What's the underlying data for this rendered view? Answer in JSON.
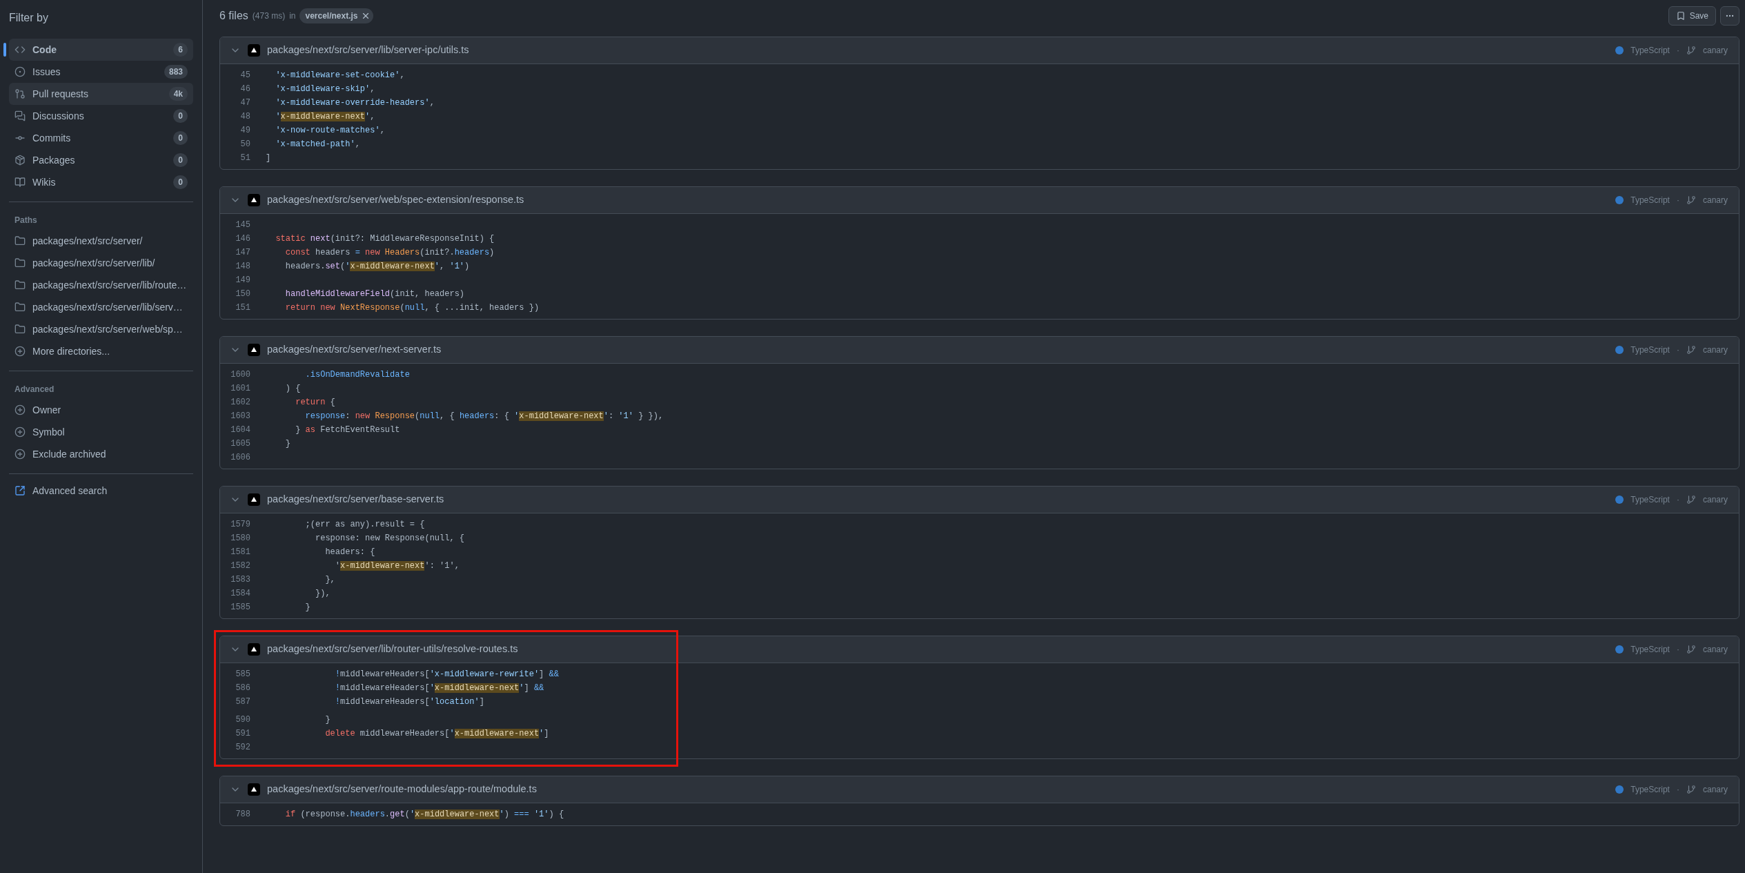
{
  "sidebar": {
    "title": "Filter by",
    "types": [
      {
        "label": "Code",
        "count": "6",
        "selected": true,
        "hovered": false
      },
      {
        "label": "Issues",
        "count": "883",
        "selected": false,
        "hovered": false
      },
      {
        "label": "Pull requests",
        "count": "4k",
        "selected": false,
        "hovered": true
      },
      {
        "label": "Discussions",
        "count": "0",
        "selected": false,
        "hovered": false
      },
      {
        "label": "Commits",
        "count": "0",
        "selected": false,
        "hovered": false
      },
      {
        "label": "Packages",
        "count": "0",
        "selected": false,
        "hovered": false
      },
      {
        "label": "Wikis",
        "count": "0",
        "selected": false,
        "hovered": false
      }
    ],
    "paths_heading": "Paths",
    "paths": [
      "packages/next/src/server/",
      "packages/next/src/server/lib/",
      "packages/next/src/server/lib/route…",
      "packages/next/src/server/lib/serv…",
      "packages/next/src/server/web/sp…"
    ],
    "more_directories": "More directories...",
    "advanced_heading": "Advanced",
    "advanced": [
      "Owner",
      "Symbol",
      "Exclude archived"
    ],
    "advanced_search": "Advanced search"
  },
  "results": {
    "count": "6 files",
    "timing": "(473 ms)",
    "in": "in",
    "repo": "vercel/next.js",
    "save": "Save"
  },
  "files": [
    {
      "path": "packages/next/src/server/lib/server-ipc/utils.ts",
      "language": "TypeScript",
      "color": "#3178c6",
      "separator": "·",
      "branch": "canary",
      "annotated": false,
      "lines": [
        {
          "number": "45",
          "tokens": [
            {
              "kind": "string",
              "text": "  'x-middleware-set-cookie'"
            },
            {
              "kind": "plain",
              "text": ","
            }
          ]
        },
        {
          "number": "46",
          "tokens": [
            {
              "kind": "string",
              "text": "  'x-middleware-skip'"
            },
            {
              "kind": "plain",
              "text": ","
            }
          ]
        },
        {
          "number": "47",
          "tokens": [
            {
              "kind": "string",
              "text": "  'x-middleware-override-headers'"
            },
            {
              "kind": "plain",
              "text": ","
            }
          ]
        },
        {
          "number": "48",
          "tokens": [
            {
              "kind": "string",
              "text": "  '"
            },
            {
              "kind": "match",
              "text": "x-middleware-next"
            },
            {
              "kind": "string",
              "text": "'"
            },
            {
              "kind": "plain",
              "text": ","
            }
          ]
        },
        {
          "number": "49",
          "tokens": [
            {
              "kind": "string",
              "text": "  'x-now-route-matches'"
            },
            {
              "kind": "plain",
              "text": ","
            }
          ]
        },
        {
          "number": "50",
          "tokens": [
            {
              "kind": "string",
              "text": "  'x-matched-path'"
            },
            {
              "kind": "plain",
              "text": ","
            }
          ]
        },
        {
          "number": "51",
          "tokens": [
            {
              "kind": "plain",
              "text": "]"
            }
          ]
        }
      ]
    },
    {
      "path": "packages/next/src/server/web/spec-extension/response.ts",
      "language": "TypeScript",
      "color": "#3178c6",
      "separator": "·",
      "branch": "canary",
      "annotated": false,
      "lines": [
        {
          "number": "145"
        },
        {
          "number": "146",
          "tokens": [
            {
              "kind": "keyword",
              "text": "  static"
            },
            {
              "kind": "func",
              "text": " next"
            },
            {
              "kind": "plain",
              "text": "(init?: MiddlewareResponseInit) {"
            }
          ]
        },
        {
          "number": "147",
          "tokens": [
            {
              "kind": "keyword",
              "text": "    const"
            },
            {
              "kind": "plain",
              "text": " headers "
            },
            {
              "kind": "constant",
              "text": "="
            },
            {
              "kind": "keyword",
              "text": " new"
            },
            {
              "kind": "type",
              "text": " Headers"
            },
            {
              "kind": "plain",
              "text": "(init?."
            },
            {
              "kind": "constant",
              "text": "headers"
            },
            {
              "kind": "plain",
              "text": ")"
            }
          ]
        },
        {
          "number": "148",
          "tokens": [
            {
              "kind": "plain",
              "text": "    headers."
            },
            {
              "kind": "func",
              "text": "set"
            },
            {
              "kind": "plain",
              "text": "("
            },
            {
              "kind": "string",
              "text": "'"
            },
            {
              "kind": "match",
              "text": "x-middleware-next"
            },
            {
              "kind": "string",
              "text": "'"
            },
            {
              "kind": "plain",
              "text": ", "
            },
            {
              "kind": "string",
              "text": "'1'"
            },
            {
              "kind": "plain",
              "text": ")"
            }
          ]
        },
        {
          "number": "149"
        },
        {
          "number": "150",
          "tokens": [
            {
              "kind": "func",
              "text": "    handleMiddlewareField"
            },
            {
              "kind": "plain",
              "text": "(init, headers)"
            }
          ]
        },
        {
          "number": "151",
          "tokens": [
            {
              "kind": "keyword",
              "text": "    return"
            },
            {
              "kind": "keyword",
              "text": " new"
            },
            {
              "kind": "type",
              "text": " NextResponse"
            },
            {
              "kind": "plain",
              "text": "("
            },
            {
              "kind": "constant",
              "text": "null"
            },
            {
              "kind": "plain",
              "text": ", { ...init, headers })"
            }
          ]
        }
      ]
    },
    {
      "path": "packages/next/src/server/next-server.ts",
      "language": "TypeScript",
      "color": "#3178c6",
      "separator": "·",
      "branch": "canary",
      "annotated": false,
      "lines": [
        {
          "number": "1600",
          "tokens": [
            {
              "kind": "constant",
              "text": "        .isOnDemandRevalidate"
            }
          ]
        },
        {
          "number": "1601",
          "tokens": [
            {
              "kind": "plain",
              "text": "    ) {"
            }
          ]
        },
        {
          "number": "1602",
          "tokens": [
            {
              "kind": "keyword",
              "text": "      return"
            },
            {
              "kind": "plain",
              "text": " {"
            }
          ]
        },
        {
          "number": "1603",
          "tokens": [
            {
              "kind": "constant",
              "text": "        response"
            },
            {
              "kind": "plain",
              "text": ": "
            },
            {
              "kind": "keyword",
              "text": "new"
            },
            {
              "kind": "type",
              "text": " Response"
            },
            {
              "kind": "plain",
              "text": "("
            },
            {
              "kind": "constant",
              "text": "null"
            },
            {
              "kind": "plain",
              "text": ", { "
            },
            {
              "kind": "constant",
              "text": "headers"
            },
            {
              "kind": "plain",
              "text": ": { "
            },
            {
              "kind": "string",
              "text": "'"
            },
            {
              "kind": "match",
              "text": "x-middleware-next"
            },
            {
              "kind": "string",
              "text": "'"
            },
            {
              "kind": "plain",
              "text": ": "
            },
            {
              "kind": "string",
              "text": "'1'"
            },
            {
              "kind": "plain",
              "text": " } }),"
            }
          ]
        },
        {
          "number": "1604",
          "tokens": [
            {
              "kind": "plain",
              "text": "      } "
            },
            {
              "kind": "keyword",
              "text": "as"
            },
            {
              "kind": "plain",
              "text": " FetchEventResult"
            }
          ]
        },
        {
          "number": "1605",
          "tokens": [
            {
              "kind": "plain",
              "text": "    }"
            }
          ]
        },
        {
          "number": "1606"
        }
      ]
    },
    {
      "path": "packages/next/src/server/base-server.ts",
      "language": "TypeScript",
      "color": "#3178c6",
      "separator": "·",
      "branch": "canary",
      "annotated": false,
      "lines": [
        {
          "number": "1579",
          "tokens": [
            {
              "kind": "plain",
              "text": "        ;(err as any).result = {"
            }
          ]
        },
        {
          "number": "1580",
          "tokens": [
            {
              "kind": "plain",
              "text": "          response: new Response(null, {"
            }
          ]
        },
        {
          "number": "1581",
          "tokens": [
            {
              "kind": "plain",
              "text": "            headers: {"
            }
          ]
        },
        {
          "number": "1582",
          "tokens": [
            {
              "kind": "plain",
              "text": "              '"
            },
            {
              "kind": "match",
              "text": "x-middleware-next"
            },
            {
              "kind": "plain",
              "text": "': '1',"
            }
          ]
        },
        {
          "number": "1583",
          "tokens": [
            {
              "kind": "plain",
              "text": "            },"
            }
          ]
        },
        {
          "number": "1584",
          "tokens": [
            {
              "kind": "plain",
              "text": "          }),"
            }
          ]
        },
        {
          "number": "1585",
          "tokens": [
            {
              "kind": "plain",
              "text": "        }"
            }
          ]
        }
      ]
    },
    {
      "path": "packages/next/src/server/lib/router-utils/resolve-routes.ts",
      "language": "TypeScript",
      "color": "#3178c6",
      "separator": "·",
      "branch": "canary",
      "annotated": true,
      "lines": [
        {
          "number": "585",
          "tokens": [
            {
              "kind": "constant",
              "text": "              !"
            },
            {
              "kind": "plain",
              "text": "middlewareHeaders["
            },
            {
              "kind": "string",
              "text": "'x-middleware-rewrite'"
            },
            {
              "kind": "plain",
              "text": "] "
            },
            {
              "kind": "constant",
              "text": "&&"
            }
          ]
        },
        {
          "number": "586",
          "tokens": [
            {
              "kind": "constant",
              "text": "              !"
            },
            {
              "kind": "plain",
              "text": "middlewareHeaders["
            },
            {
              "kind": "string",
              "text": "'"
            },
            {
              "kind": "match",
              "text": "x-middleware-next"
            },
            {
              "kind": "string",
              "text": "'"
            },
            {
              "kind": "plain",
              "text": "] "
            },
            {
              "kind": "constant",
              "text": "&&"
            }
          ]
        },
        {
          "number": "587",
          "tokens": [
            {
              "kind": "constant",
              "text": "              !"
            },
            {
              "kind": "plain",
              "text": "middlewareHeaders["
            },
            {
              "kind": "string",
              "text": "'location'"
            },
            {
              "kind": "plain",
              "text": "]"
            }
          ]
        },
        {
          "number": "590",
          "break_before": true,
          "tokens": [
            {
              "kind": "plain",
              "text": "            }"
            }
          ]
        },
        {
          "number": "591",
          "tokens": [
            {
              "kind": "keyword",
              "text": "            delete"
            },
            {
              "kind": "plain",
              "text": " middlewareHeaders["
            },
            {
              "kind": "string",
              "text": "'"
            },
            {
              "kind": "match",
              "text": "x-middleware-next"
            },
            {
              "kind": "string",
              "text": "'"
            },
            {
              "kind": "plain",
              "text": "]"
            }
          ]
        },
        {
          "number": "592"
        }
      ]
    },
    {
      "path": "packages/next/src/server/route-modules/app-route/module.ts",
      "language": "TypeScript",
      "color": "#3178c6",
      "separator": "·",
      "branch": "canary",
      "annotated": false,
      "lines": [
        {
          "number": "788",
          "tokens": [
            {
              "kind": "keyword",
              "text": "    if"
            },
            {
              "kind": "plain",
              "text": " (response."
            },
            {
              "kind": "constant",
              "text": "headers"
            },
            {
              "kind": "plain",
              "text": "."
            },
            {
              "kind": "func",
              "text": "get"
            },
            {
              "kind": "plain",
              "text": "("
            },
            {
              "kind": "string",
              "text": "'"
            },
            {
              "kind": "match",
              "text": "x-middleware-next"
            },
            {
              "kind": "string",
              "text": "'"
            },
            {
              "kind": "plain",
              "text": ") "
            },
            {
              "kind": "constant",
              "text": "==="
            },
            {
              "kind": "string",
              "text": " '1'"
            },
            {
              "kind": "plain",
              "text": ") {"
            }
          ]
        }
      ]
    }
  ]
}
